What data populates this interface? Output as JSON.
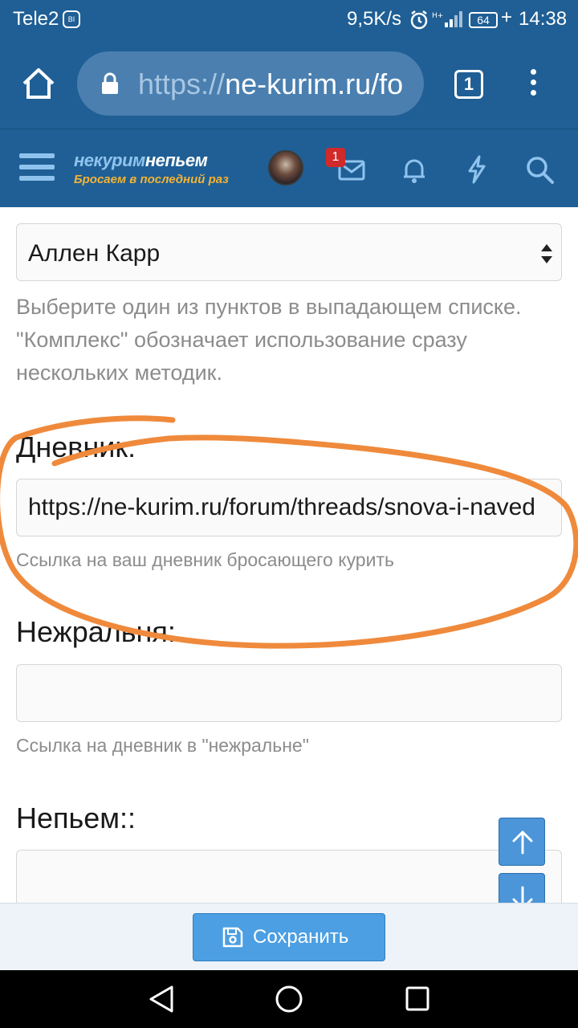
{
  "status_bar": {
    "carrier": "Tele2",
    "carrier_icon_text": "BI",
    "net_speed": "9,5K/s",
    "battery": "64",
    "charging": "+",
    "time": "14:38"
  },
  "browser": {
    "url_scheme": "https://",
    "url_host": "ne-kurim.ru/fo",
    "tab_count": "1"
  },
  "site_header": {
    "logo_line1_a": "некурим",
    "logo_line1_b": "непьем",
    "logo_line2": "Бросаем в последний раз",
    "inbox_badge": "1"
  },
  "form": {
    "method_select_value": "Аллен Карр",
    "method_hint": "Выберите один из пунктов в выпадающем списке. \"Комплекс\" обозначает использование сразу нескольких методик.",
    "diary_label": "Дневник:",
    "diary_value": "https://ne-kurim.ru/forum/threads/snova-i-naved",
    "diary_hint": "Ссылка на ваш дневник бросающего курить",
    "nezhralnya_label": "Нежральня:",
    "nezhralnya_value": "",
    "nezhralnya_hint": "Ссылка на дневник в \"нежральне\"",
    "nepyem_label": "Непьем::",
    "nepyem_value": ""
  },
  "save_bar": {
    "save_label": "Сохранить"
  },
  "colors": {
    "brand_blue": "#1f5f95",
    "button_blue": "#4b9fe2",
    "annotation_orange": "#ef8a3c",
    "badge_red": "#d12a2a"
  }
}
